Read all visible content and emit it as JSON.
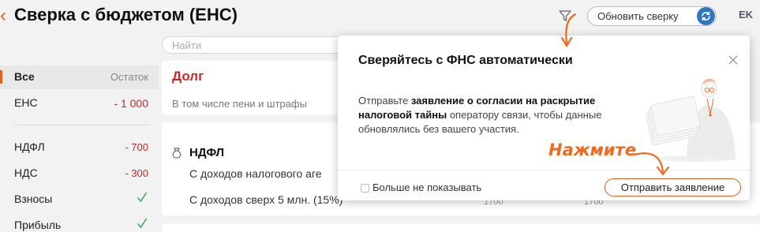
{
  "header": {
    "title": "Сверка с бюджетом (ЕНС)",
    "refresh_label": "Обновить сверку",
    "user_initials": "EK"
  },
  "search": {
    "placeholder": "Найти"
  },
  "sidebar": {
    "items": [
      {
        "label": "Все",
        "value": "Остаток"
      },
      {
        "label": "ЕНС",
        "value": "- 1 000"
      },
      {
        "label": "НДФЛ",
        "value": "- 700"
      },
      {
        "label": "НДС",
        "value": "- 300"
      },
      {
        "label": "Взносы",
        "value": ""
      },
      {
        "label": "Прибыль",
        "value": ""
      }
    ]
  },
  "main": {
    "debt_title": "Долг",
    "debt_subtitle": "В том числе пени и штрафы",
    "ndfl_title": "НДФЛ",
    "rows": [
      {
        "text": "С доходов налогового аге",
        "v1": "",
        "v2": ""
      },
      {
        "text": "С доходов сверх 5 млн. (15%)",
        "v1": "1700",
        "v2": "1700"
      }
    ]
  },
  "modal": {
    "title": "Сверяйтесь с ФНС автоматически",
    "body_pre": "Отправьте ",
    "body_bold": "заявление о согласии на раскрытие налоговой тайны",
    "body_post": " оператору связи, чтобы данные обновлялись без вашего участия.",
    "checkbox_label": "Больше не показывать",
    "send_label": "Отправить заявление"
  },
  "hint": {
    "text": "Нажмите"
  },
  "colors": {
    "accent": "#e2611e",
    "debt": "#c62828",
    "refresh_icon": "#2b78c5",
    "ok": "#3aa655"
  },
  "icons": [
    "back-chevron-icon",
    "filter-icon",
    "refresh-icon",
    "close-icon",
    "check-icon",
    "tax-bag-icon",
    "checkbox-icon"
  ]
}
